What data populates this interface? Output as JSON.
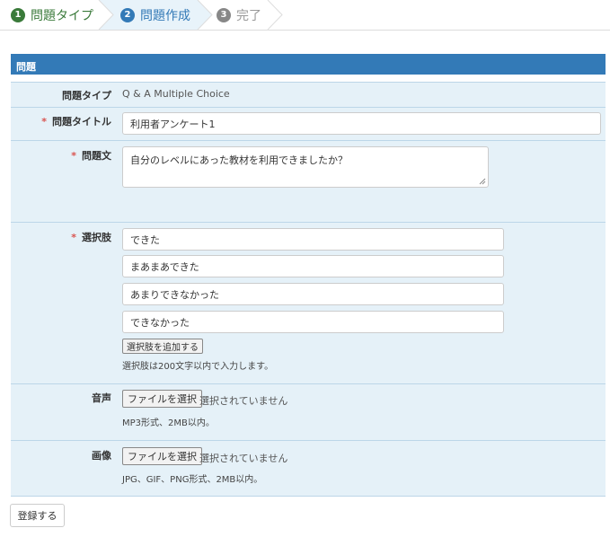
{
  "stepper": {
    "steps": [
      {
        "num": "1",
        "label": "問題タイプ"
      },
      {
        "num": "2",
        "label": "問題作成"
      },
      {
        "num": "3",
        "label": "完了"
      }
    ]
  },
  "panel": {
    "title": "問題"
  },
  "form": {
    "type_label": "問題タイプ",
    "type_value": "Q & A Multiple Choice",
    "title_label": "問題タイトル",
    "title_value": "利用者アンケート1",
    "text_label": "問題文",
    "text_value": "自分のレベルにあった教材を利用できましたか？",
    "choices_label": "選択肢",
    "choices": [
      "できた",
      "まあまあできた",
      "あまりできなかった",
      "できなかった"
    ],
    "add_choice_label": "選択肢を追加する",
    "choices_help": "選択肢は200文字以内で入力します。",
    "audio_label": "音声",
    "audio_button": "ファイルを選択",
    "audio_status": "選択されていません",
    "audio_help": "MP3形式、2MB以内。",
    "image_label": "画像",
    "image_button": "ファイルを選択",
    "image_status": "選択されていません",
    "image_help": "JPG、GIF、PNG形式、2MB以内。",
    "required_mark": "*",
    "submit_label": "登録する"
  },
  "colors": {
    "accent": "#337ab7",
    "step_done": "#3a7a3a",
    "panel_body": "#e5f1f8",
    "required": "#d9534f"
  }
}
